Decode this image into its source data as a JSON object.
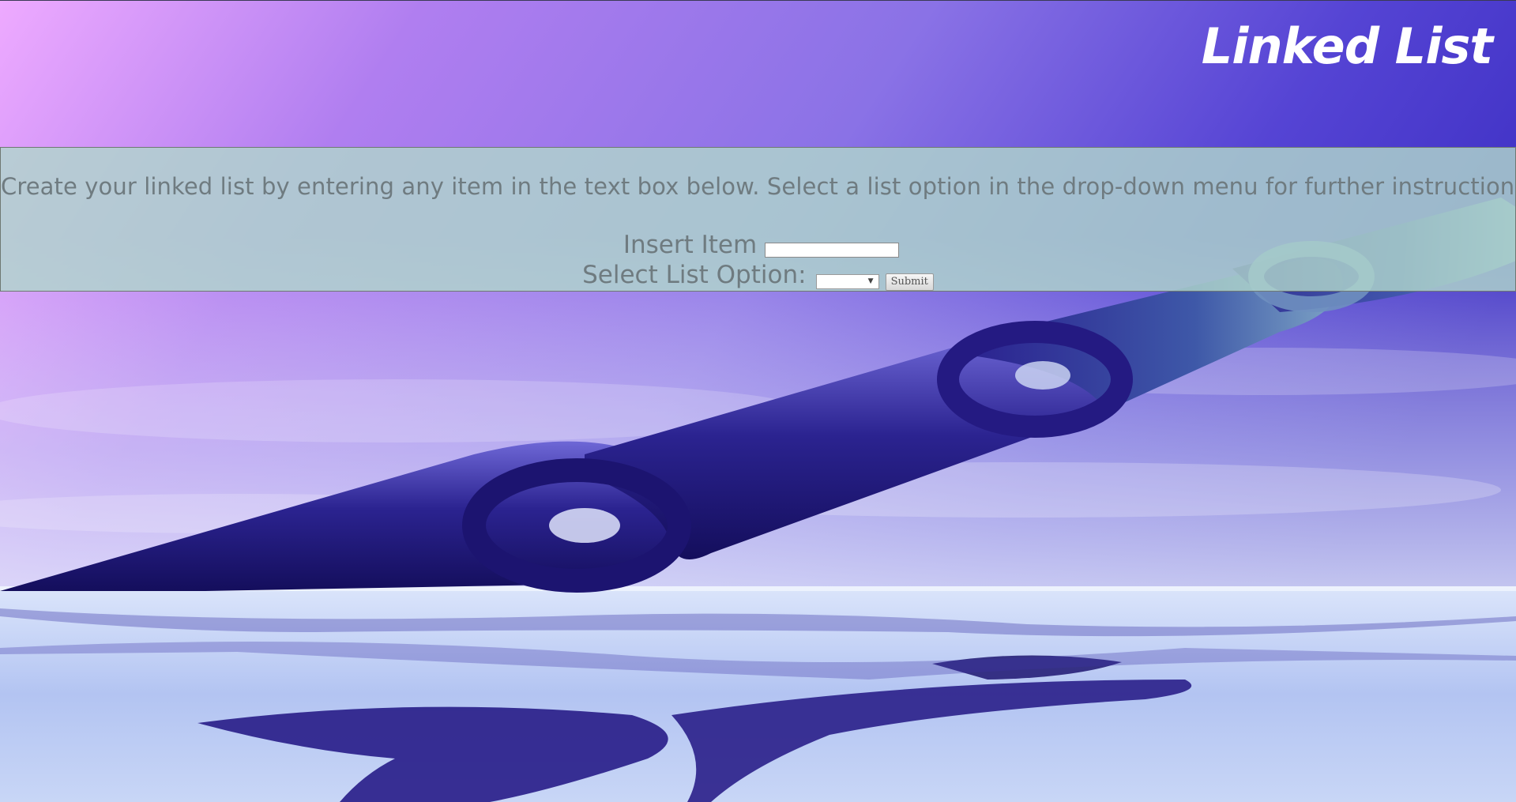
{
  "header": {
    "title": "Linked List"
  },
  "panel": {
    "instructions": "Create your linked list by entering any item in the text box below. Select a list option in the drop-down menu for further instructions.",
    "insert_label": "Insert Item",
    "insert_value": "",
    "select_label": "Select List Option:",
    "select_value": "",
    "submit_label": "Submit"
  },
  "icons": {
    "dropdown": "chevron-down-icon"
  },
  "colors": {
    "title": "#ffffff",
    "panel_text": "#6f7b80",
    "panel_bg": "#b0d6cc",
    "sky_top_left": "#e6a8ff",
    "sky_top_right": "#3c2cc0",
    "chain": "#2a1f8a",
    "water": "#c9d8f6"
  }
}
